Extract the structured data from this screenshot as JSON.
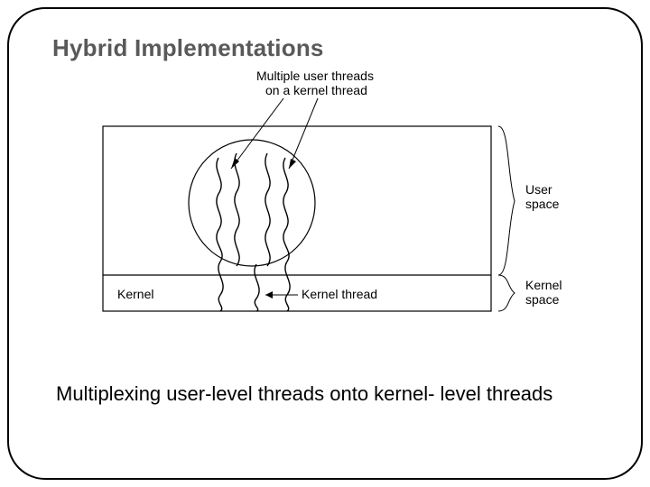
{
  "title": "Hybrid Implementations",
  "caption": "Multiplexing user-level threads onto kernel- level threads",
  "diagram": {
    "top_label_line1": "Multiple user threads",
    "top_label_line2": "on a kernel thread",
    "user_space_label": "User",
    "user_space_label2": "space",
    "kernel_space_label": "Kernel",
    "kernel_space_label2": "space",
    "kernel_label": "Kernel",
    "kernel_thread_label": "Kernel thread"
  }
}
